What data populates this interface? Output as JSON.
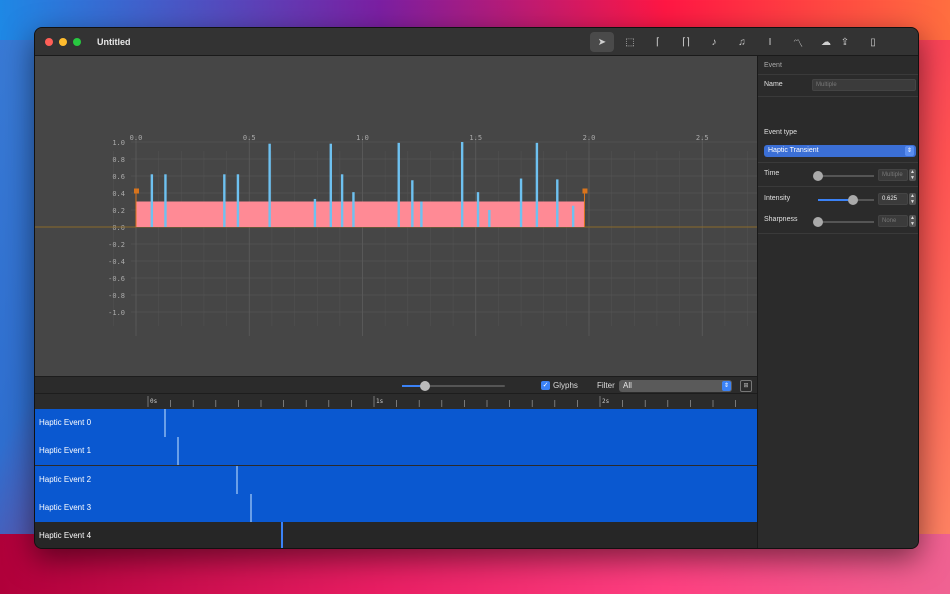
{
  "window": {
    "title": "Untitled"
  },
  "toolbar": {
    "tools": [
      {
        "name": "pointer-tool",
        "glyph": "➤",
        "active": true
      },
      {
        "name": "marquee-tool",
        "glyph": "⬚",
        "active": false
      },
      {
        "name": "continuous-event-tool",
        "glyph": "⌈",
        "active": false
      },
      {
        "name": "continuous-pair-tool",
        "glyph": "⌈⌉",
        "active": false
      },
      {
        "name": "transient-note-tool",
        "glyph": "♪",
        "active": false
      },
      {
        "name": "transient-pair-tool",
        "glyph": "♫",
        "active": false
      },
      {
        "name": "text-cursor-tool",
        "glyph": "I",
        "active": false
      },
      {
        "name": "curve-tool",
        "glyph": "〽",
        "active": false
      },
      {
        "name": "cloud-upload-tool",
        "glyph": "☁",
        "active": false
      }
    ],
    "right_tools": [
      {
        "name": "share-tool",
        "glyph": "⇪"
      },
      {
        "name": "device-tool",
        "glyph": "▯"
      }
    ]
  },
  "graph": {
    "x_ticks": [
      "0.0",
      "0.5",
      "1.0",
      "1.5",
      "2.0",
      "2.5"
    ],
    "y_ticks": [
      "1.0",
      "0.8",
      "0.6",
      "0.4",
      "0.2",
      "0.0",
      "-0.2",
      "-0.4",
      "-0.6",
      "-0.8",
      "-1.0"
    ],
    "continuous_event": {
      "start": 0.0,
      "end": 1.98,
      "intensity": 0.3
    },
    "transients": [
      {
        "t": 0.07,
        "v": 0.62
      },
      {
        "t": 0.13,
        "v": 0.62
      },
      {
        "t": 0.39,
        "v": 0.62
      },
      {
        "t": 0.45,
        "v": 0.62
      },
      {
        "t": 0.59,
        "v": 0.98
      },
      {
        "t": 0.79,
        "v": 0.33
      },
      {
        "t": 0.86,
        "v": 0.98
      },
      {
        "t": 0.91,
        "v": 0.62
      },
      {
        "t": 0.96,
        "v": 0.41
      },
      {
        "t": 1.16,
        "v": 0.99
      },
      {
        "t": 1.22,
        "v": 0.55
      },
      {
        "t": 1.26,
        "v": 0.3
      },
      {
        "t": 1.44,
        "v": 1.0
      },
      {
        "t": 1.51,
        "v": 0.41
      },
      {
        "t": 1.56,
        "v": 0.2
      },
      {
        "t": 1.7,
        "v": 0.57
      },
      {
        "t": 1.77,
        "v": 0.99
      },
      {
        "t": 1.86,
        "v": 0.56
      },
      {
        "t": 1.93,
        "v": 0.25
      }
    ]
  },
  "controls": {
    "zoom_level": 0.22,
    "glyphs_label": "Glyphs",
    "glyphs_checked": true,
    "filter_label": "Filter",
    "filter_value": "All"
  },
  "ruler": {
    "labels": [
      "0s",
      "1s",
      "2s"
    ]
  },
  "tracks": [
    {
      "label": "Haptic Event 0",
      "selected": true,
      "t": 0.07
    },
    {
      "label": "Haptic Event 1",
      "selected": true,
      "t": 0.13
    },
    {
      "label": "Haptic Event 2",
      "selected": true,
      "t": 0.39
    },
    {
      "label": "Haptic Event 3",
      "selected": true,
      "t": 0.45
    },
    {
      "label": "Haptic Event 4",
      "selected": false,
      "t": 0.59
    }
  ],
  "inspector": {
    "section_title": "Event",
    "name_label": "Name",
    "name_placeholder": "Multiple",
    "event_type_label": "Event type",
    "event_type_value": "Haptic Transient",
    "time_label": "Time",
    "time_placeholder": "Multiple",
    "time_level": 0.0,
    "intensity_label": "Intensity",
    "intensity_value": "0.625",
    "intensity_level": 0.625,
    "sharpness_label": "Sharpness",
    "sharpness_placeholder": "None",
    "sharpness_level": 0.0
  },
  "colors": {
    "accent": "#3b82f6",
    "continuous_fill": "#ff8a95",
    "transient_bar": "#6ec1f0",
    "selected_track": "#0a58d0",
    "marker": "#d9741c"
  }
}
